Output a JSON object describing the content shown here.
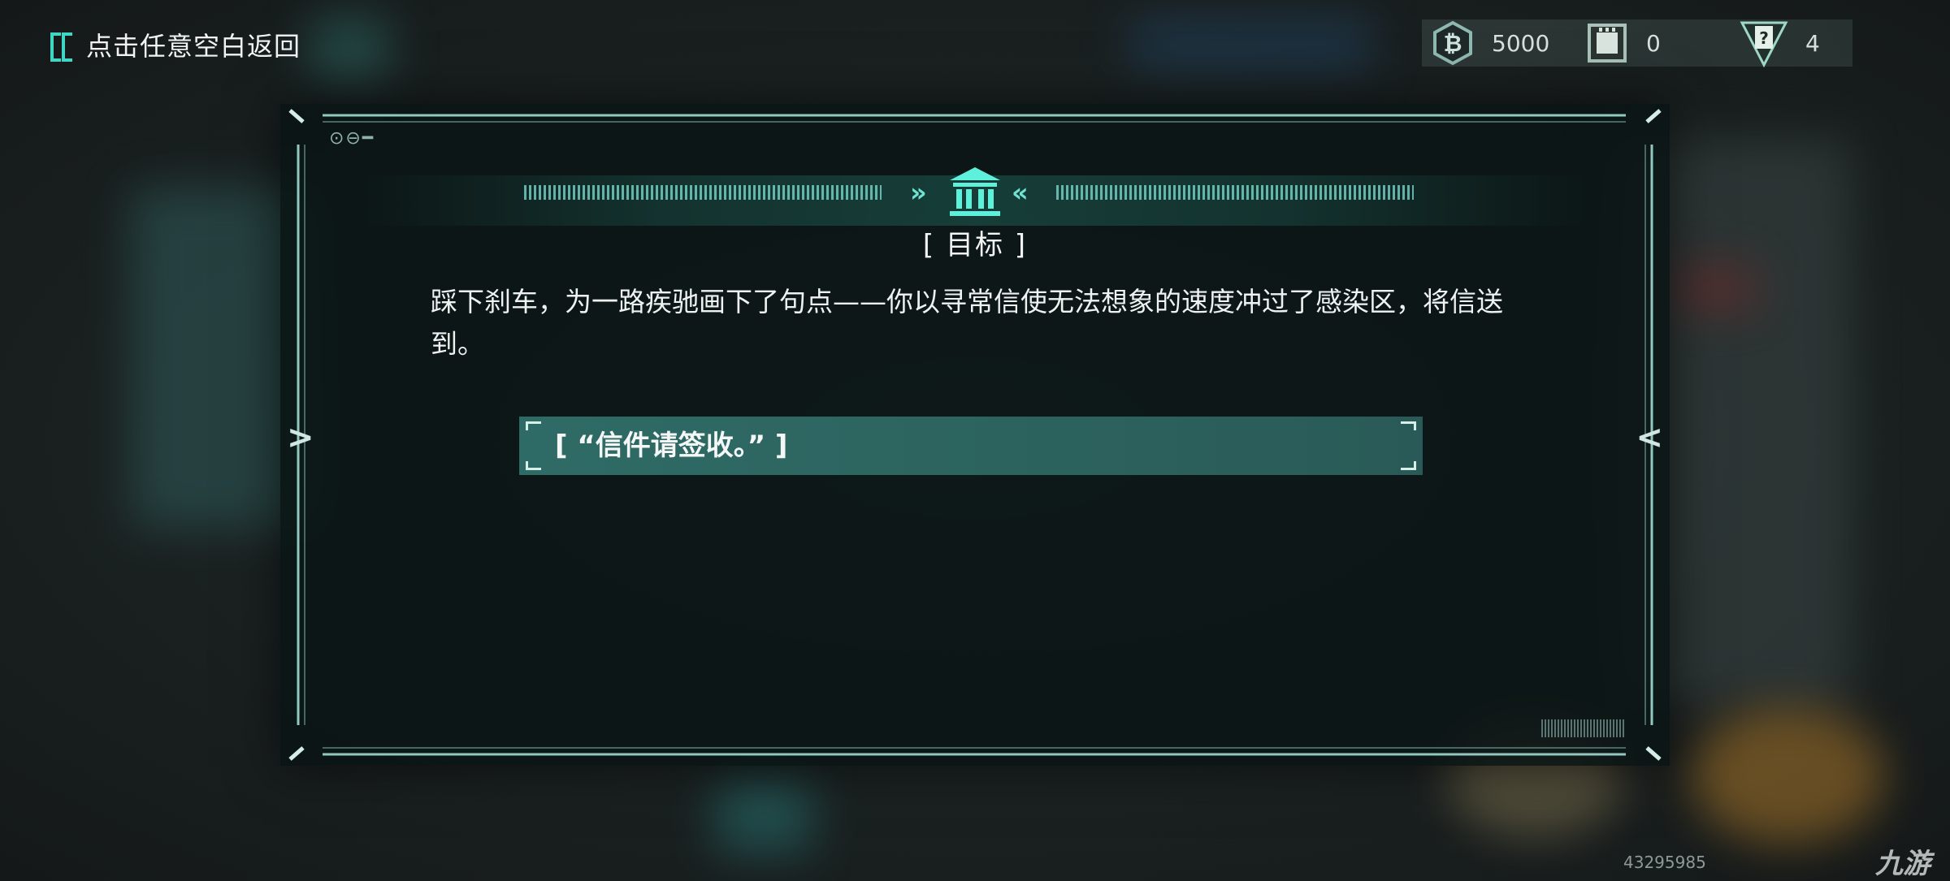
{
  "back_hint": {
    "label": "点击任意空白返回"
  },
  "currencies": [
    {
      "icon": "bitcoin-coin-icon",
      "value": "5000"
    },
    {
      "icon": "chip-card-icon",
      "value": "0"
    },
    {
      "icon": "mystery-card-icon",
      "value": "4"
    }
  ],
  "dialog": {
    "header_icon": "museum-building-icon",
    "title": "[ 目标 ]",
    "description": "踩下刹车，为一路疾驰画下了句点——你以寻常信使无法想象的速度冲过了感染区，将信送到。",
    "choice": "[ “信件请签收。” ]",
    "deco_dots": "⊙⊖━"
  },
  "footer": {
    "id_text": "43295985",
    "watermark": "九游"
  },
  "colors": {
    "accent": "#3fd6c4",
    "choice_bg": "#2f6b66",
    "panel_bg": "#0a1414"
  }
}
